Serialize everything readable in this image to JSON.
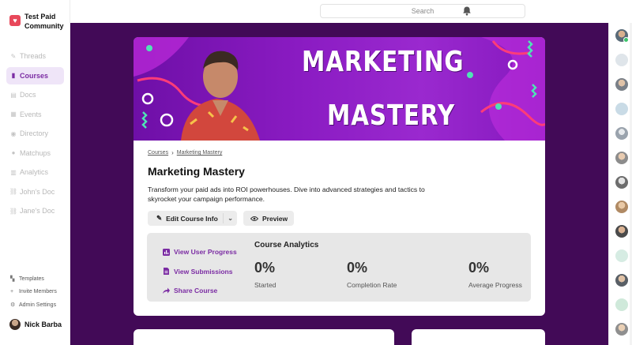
{
  "brand": {
    "name": "Test Paid Community",
    "logo_icon": "heart-icon",
    "logo_color": "#e8485b"
  },
  "sidebar": {
    "items": [
      {
        "label": "Threads",
        "icon": "threads-icon",
        "active": false
      },
      {
        "label": "Courses",
        "icon": "courses-icon",
        "active": true
      },
      {
        "label": "Docs",
        "icon": "docs-icon",
        "active": false
      },
      {
        "label": "Events",
        "icon": "events-icon",
        "active": false
      },
      {
        "label": "Directory",
        "icon": "directory-icon",
        "active": false
      },
      {
        "label": "Matchups",
        "icon": "matchups-icon",
        "active": false
      },
      {
        "label": "Analytics",
        "icon": "analytics-icon",
        "active": false
      },
      {
        "label": "John's Doc",
        "icon": "link-icon",
        "active": false
      },
      {
        "label": "Jane's Doc",
        "icon": "link-icon",
        "active": false
      }
    ],
    "bottom_links": [
      {
        "label": "Templates",
        "icon": "templates-icon"
      },
      {
        "label": "Invite Members",
        "icon": "plus-icon"
      },
      {
        "label": "Admin Settings",
        "icon": "gear-icon"
      }
    ],
    "user": {
      "name": "Nick Barba"
    }
  },
  "topbar": {
    "search_placeholder": "Search",
    "bell_icon": "bell-icon"
  },
  "course": {
    "banner": {
      "line1": "MARKETING",
      "line2": "MASTERY"
    },
    "breadcrumb": {
      "root": "Courses",
      "current": "Marketing Mastery"
    },
    "title": "Marketing Mastery",
    "description": "Transform your paid ads into ROI powerhouses. Dive into advanced strategies and tactics to skyrocket your campaign performance.",
    "edit_button": "Edit Course Info",
    "preview_button": "Preview"
  },
  "analytics": {
    "links": [
      {
        "label": "View User Progress",
        "icon": "bar-chart-icon"
      },
      {
        "label": "View Submissions",
        "icon": "document-icon"
      },
      {
        "label": "Share Course",
        "icon": "share-icon"
      }
    ],
    "title": "Course Analytics",
    "stats": [
      {
        "value": "0%",
        "label": "Started"
      },
      {
        "value": "0%",
        "label": "Completion Rate"
      },
      {
        "value": "0%",
        "label": "Average Progress"
      }
    ]
  },
  "colors": {
    "accent": "#7b2ca3",
    "main_bg": "#420a57",
    "banner": "#8a1bc2"
  }
}
